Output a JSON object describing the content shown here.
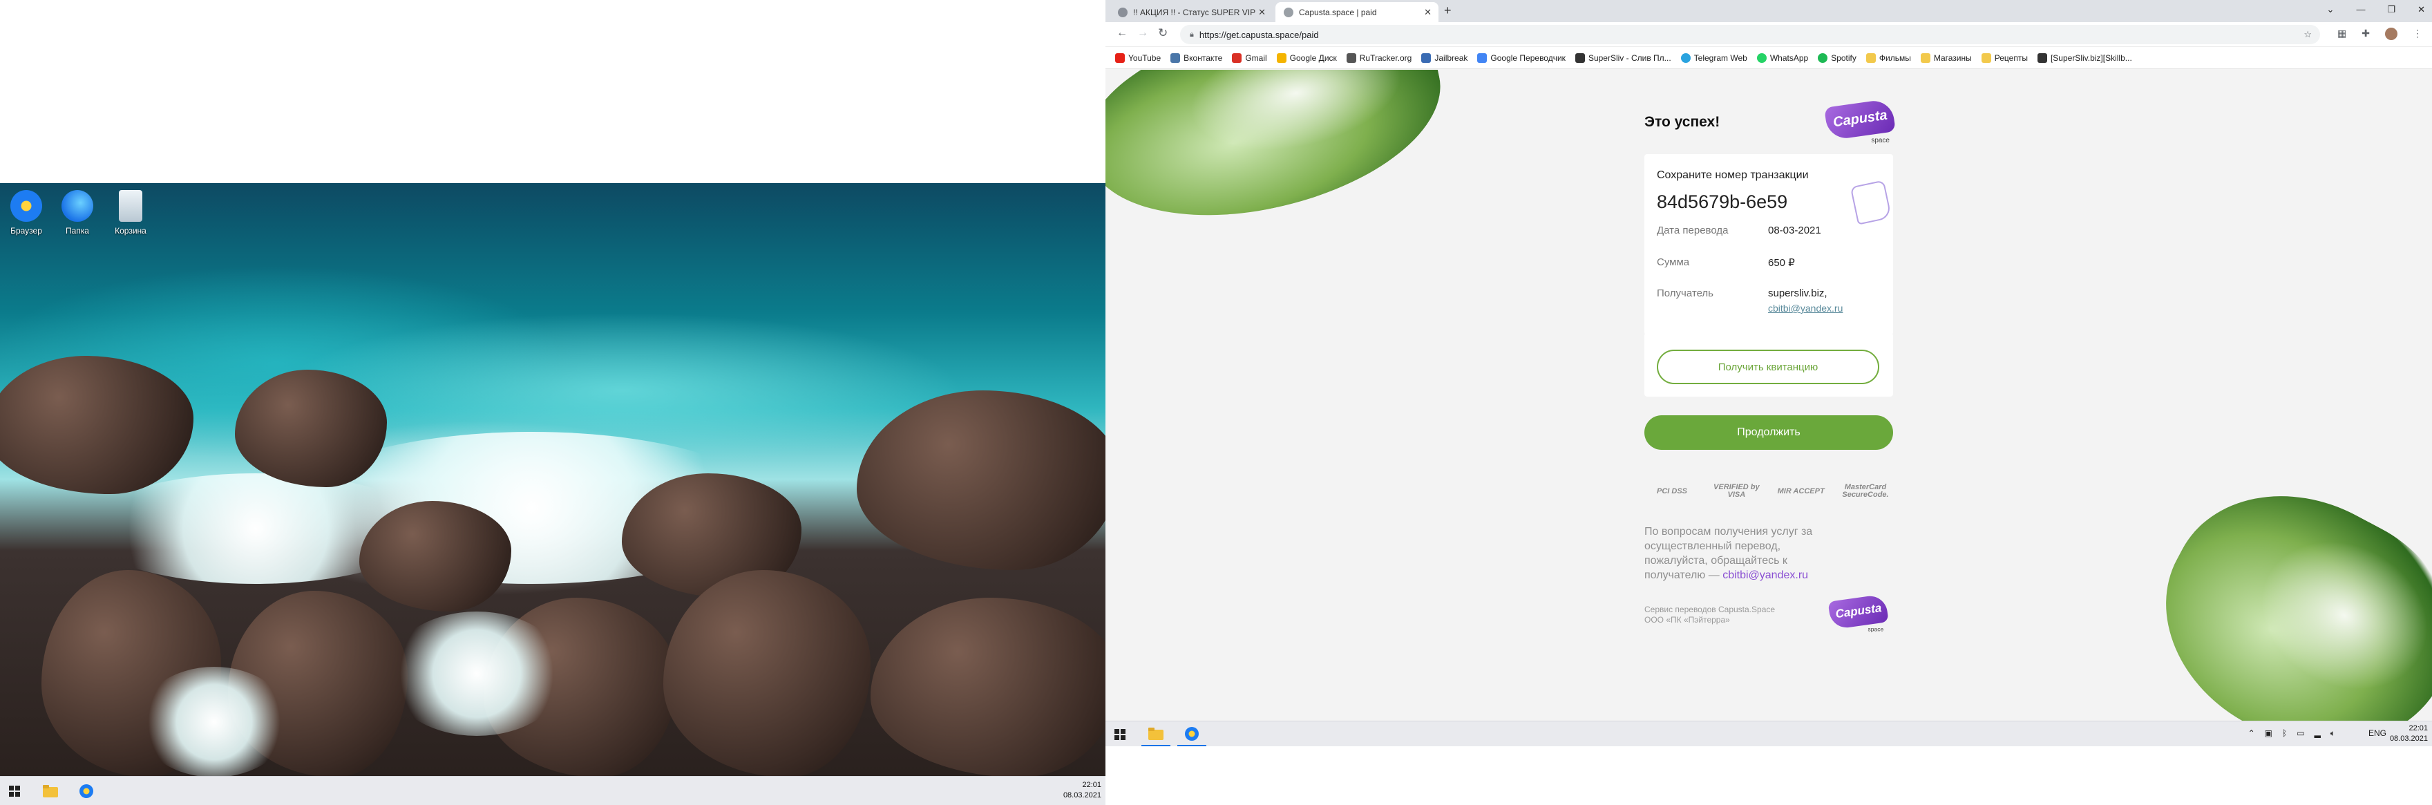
{
  "left_desktop": {
    "icons": [
      {
        "label": "Браузер",
        "icon": "browser-icon"
      },
      {
        "label": "Папка",
        "icon": "folder-icon"
      },
      {
        "label": "Корзина",
        "icon": "recycle-bin-icon"
      }
    ],
    "taskbar": {
      "time": "22:01",
      "date": "08.03.2021"
    }
  },
  "browser": {
    "tabs": [
      {
        "title": "!! АКЦИЯ !! - Статус SUPER VIP -",
        "active": false
      },
      {
        "title": "Capusta.space | paid",
        "active": true
      }
    ],
    "new_tab": "+",
    "url": "https://get.capusta.space/paid",
    "bookmarks": [
      {
        "label": "YouTube",
        "color": "#e62117"
      },
      {
        "label": "Вконтакте",
        "color": "#4a76a8"
      },
      {
        "label": "Gmail",
        "color": "#d93025"
      },
      {
        "label": "Google Диск",
        "color": "#f4b400"
      },
      {
        "label": "RuTracker.org",
        "color": "#555555"
      },
      {
        "label": "Jailbreak",
        "color": "#3a6bb3"
      },
      {
        "label": "Google Переводчик",
        "color": "#4285f4"
      },
      {
        "label": "SuperSliv - Слив Пл...",
        "color": "#333333"
      },
      {
        "label": "Telegram Web",
        "color": "#2aa3df"
      },
      {
        "label": "WhatsApp",
        "color": "#25d366"
      },
      {
        "label": "Spotify",
        "color": "#1db954"
      },
      {
        "label": "Фильмы",
        "color": "#f2c94c"
      },
      {
        "label": "Магазины",
        "color": "#f2c94c"
      },
      {
        "label": "Рецепты",
        "color": "#f2c94c"
      },
      {
        "label": "[SuperSliv.biz][Skillb...",
        "color": "#333333"
      }
    ]
  },
  "payment": {
    "title": "Это успех!",
    "logo_word": "Capusta",
    "logo_sub": "space",
    "save_label": "Сохраните номер транзакции",
    "transaction_id": "84d5679b-6e59",
    "rows": {
      "date_label": "Дата перевода",
      "date_value": "08-03-2021",
      "amount_label": "Сумма",
      "amount_value": "650 ₽",
      "recipient_label": "Получатель",
      "recipient_value": "supersliv.biz,",
      "recipient_email": "cbitbi@yandex.ru"
    },
    "receipt_button": "Получить квитанцию",
    "continue_button": "Продолжить",
    "badges": [
      "PCI DSS",
      "VERIFIED by VISA",
      "MIR ACCEPT",
      "MasterCard SecureCode."
    ],
    "support_text": "По вопросам получения услуг за осуществленный перевод, пожалуйста, обращайтесь к получателю —",
    "support_email": "cbitbi@yandex.ru",
    "footer_line1": "Сервис переводов Capusta.Space",
    "footer_line2": "ООО «ПК «Пэйтерра»"
  },
  "right_taskbar": {
    "lang": "ENG",
    "time": "22:01",
    "date": "08.03.2021"
  },
  "colors": {
    "accent_green": "#6aa83b",
    "brand_purple": "#7b3fc7",
    "page_bg": "#f3f3f3"
  }
}
